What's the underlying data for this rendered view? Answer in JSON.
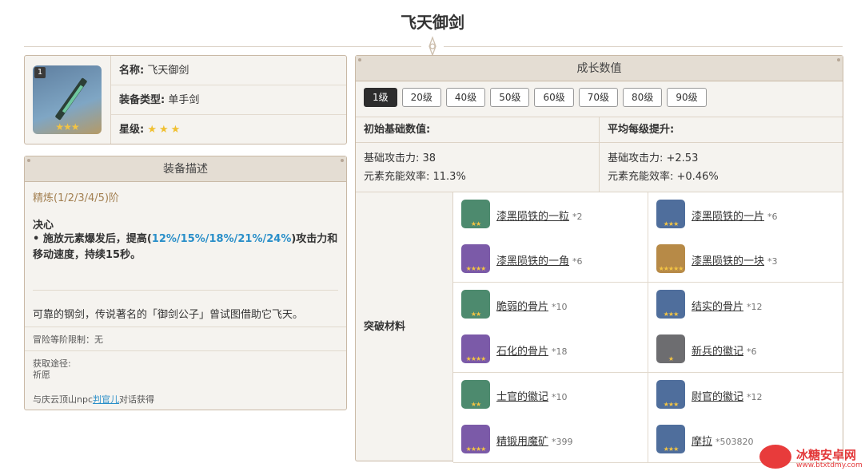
{
  "title": "飞天御剑",
  "weapon": {
    "refine_badge": "1",
    "name_label": "名称:",
    "name_value": "飞天御剑",
    "type_label": "装备类型:",
    "type_value": "单手剑",
    "rarity_label": "星级:",
    "rarity_stars": "★★★",
    "thumb_stars": "★★★"
  },
  "description": {
    "header": "装备描述",
    "refine_text": "精炼(1/2/3/4/5)阶",
    "passive_name": "决心",
    "passive_prefix": "• 施放元素爆发后，提高(",
    "passive_values": "12%/15%/18%/21%/24%",
    "passive_suffix": ")攻击力和移动速度，持续15秒。",
    "lore": "可靠的钢剑，传说著名的「御剑公子」曾试图借助它飞天。",
    "ar_limit": "冒险等阶限制：无",
    "source_label": "获取途径:",
    "source_value": "祈愿",
    "source_note_prefix": "与庆云顶山npc",
    "source_note_link": "判官儿",
    "source_note_suffix": "对话获得"
  },
  "growth": {
    "header": "成长数值",
    "levels": [
      "1级",
      "20级",
      "40级",
      "50级",
      "60级",
      "70级",
      "80级",
      "90级"
    ],
    "active_level": "1级",
    "base_header": "初始基础数值:",
    "base_atk": "基础攻击力: 38",
    "base_er": "元素充能效率: 11.3%",
    "avg_header": "平均每级提升:",
    "avg_atk": "基础攻击力: +2.53",
    "avg_er": "元素充能效率: +0.46%",
    "materials_label": "突破材料",
    "materials": [
      {
        "name": "漆黑陨铁的一粒",
        "qty": "*2",
        "color": "#4d8a6e",
        "stars": "★★",
        "icon": "ore-icon"
      },
      {
        "name": "漆黑陨铁的一片",
        "qty": "*6",
        "color": "#4f6e9c",
        "stars": "★★★",
        "icon": "ore-icon"
      },
      {
        "name": "漆黑陨铁的一角",
        "qty": "*6",
        "color": "#7b5aa8",
        "stars": "★★★★",
        "icon": "ore-icon"
      },
      {
        "name": "漆黑陨铁的一块",
        "qty": "*3",
        "color": "#b78a47",
        "stars": "★★★★★",
        "icon": "ore-icon"
      },
      {
        "name": "脆弱的骨片",
        "qty": "*10",
        "color": "#4d8a6e",
        "stars": "★★",
        "icon": "bone-icon"
      },
      {
        "name": "结实的骨片",
        "qty": "*12",
        "color": "#4f6e9c",
        "stars": "★★★",
        "icon": "bone-icon"
      },
      {
        "name": "石化的骨片",
        "qty": "*18",
        "color": "#7b5aa8",
        "stars": "★★★★",
        "icon": "bone-icon"
      },
      {
        "name": "新兵的徽记",
        "qty": "*6",
        "color": "#6d6d70",
        "stars": "★",
        "icon": "insignia-icon"
      },
      {
        "name": "士官的徽记",
        "qty": "*10",
        "color": "#4d8a6e",
        "stars": "★★",
        "icon": "insignia-icon"
      },
      {
        "name": "尉官的徽记",
        "qty": "*12",
        "color": "#4f6e9c",
        "stars": "★★★",
        "icon": "insignia-icon"
      },
      {
        "name": "精锻用魔矿",
        "qty": "*399",
        "color": "#7b5aa8",
        "stars": "★★★★",
        "icon": "crystal-icon"
      },
      {
        "name": "摩拉",
        "qty": "*503820",
        "color": "#4f6e9c",
        "stars": "★★★",
        "icon": "mora-icon"
      }
    ]
  },
  "watermark": {
    "brand": "冰糖安卓网",
    "url": "www.btxtdmy.com"
  }
}
